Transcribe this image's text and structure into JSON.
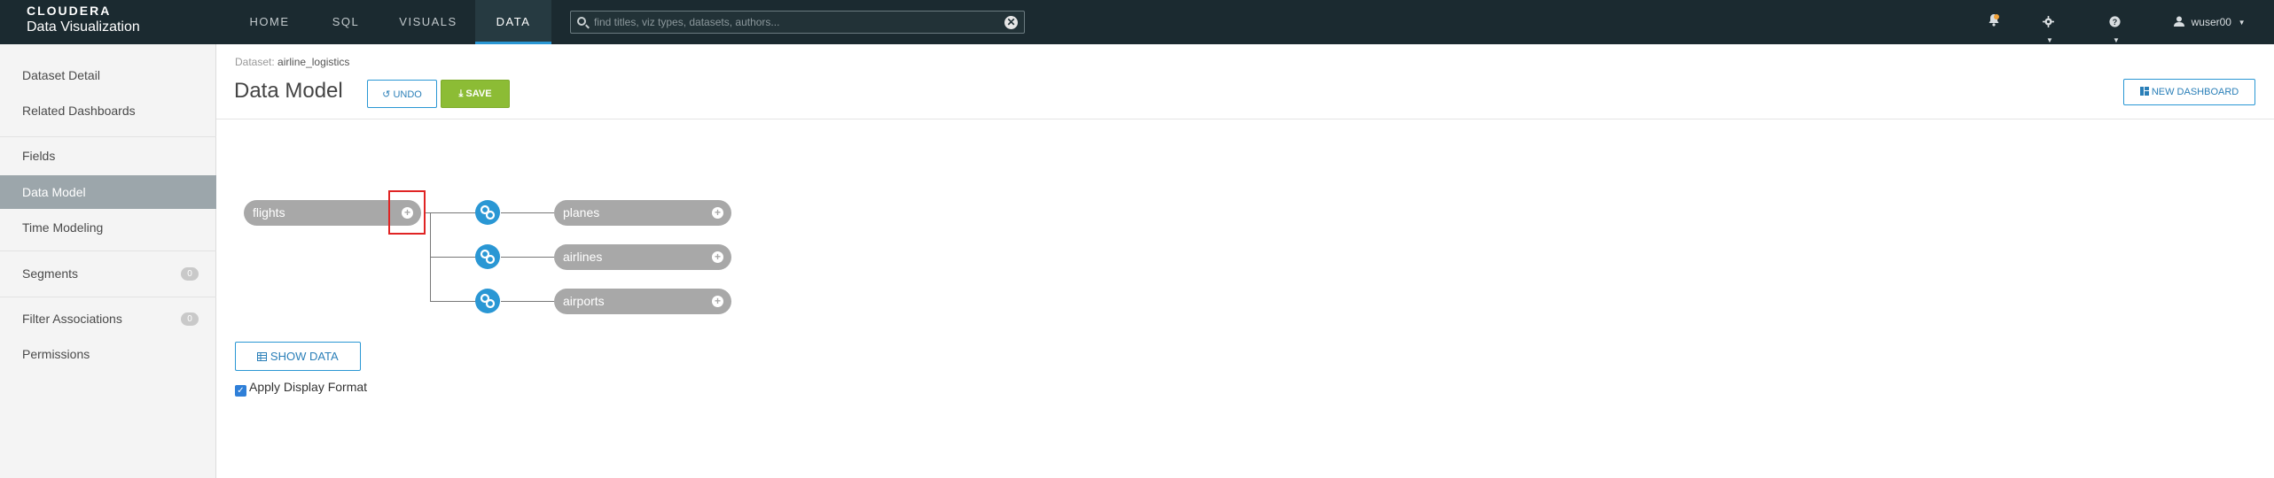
{
  "brand": {
    "name": "CLOUDERA",
    "subtitle": "Data Visualization"
  },
  "nav": {
    "tabs": [
      {
        "label": "HOME"
      },
      {
        "label": "SQL"
      },
      {
        "label": "VISUALS"
      },
      {
        "label": "DATA",
        "active": true
      }
    ]
  },
  "search": {
    "placeholder": "find titles, viz types, datasets, authors...",
    "clear_glyph": "✕"
  },
  "user": {
    "name": "wuser00"
  },
  "sidebar": {
    "items": [
      {
        "label": "Dataset Detail"
      },
      {
        "label": "Related Dashboards"
      },
      {
        "label": "Fields"
      },
      {
        "label": "Data Model",
        "active": true
      },
      {
        "label": "Time Modeling"
      },
      {
        "label": "Segments",
        "badge": "0"
      },
      {
        "label": "Filter Associations",
        "badge": "0"
      },
      {
        "label": "Permissions"
      }
    ]
  },
  "main": {
    "breadcrumb_label": "Dataset:",
    "dataset_name": "airline_logistics",
    "title": "Data Model",
    "undo_label": "UNDO",
    "save_label": "SAVE",
    "new_dashboard_label": "NEW DASHBOARD",
    "show_data_label": "SHOW DATA",
    "apply_format_label": "Apply Display Format",
    "apply_format_checked": true
  },
  "model": {
    "primary": "flights",
    "joined": [
      "planes",
      "airlines",
      "airports"
    ]
  },
  "colors": {
    "accent": "#2a97d4",
    "save": "#8cbc35",
    "topbar": "#1b2a30",
    "node": "#a8a8a8",
    "highlight": "#e02424"
  }
}
